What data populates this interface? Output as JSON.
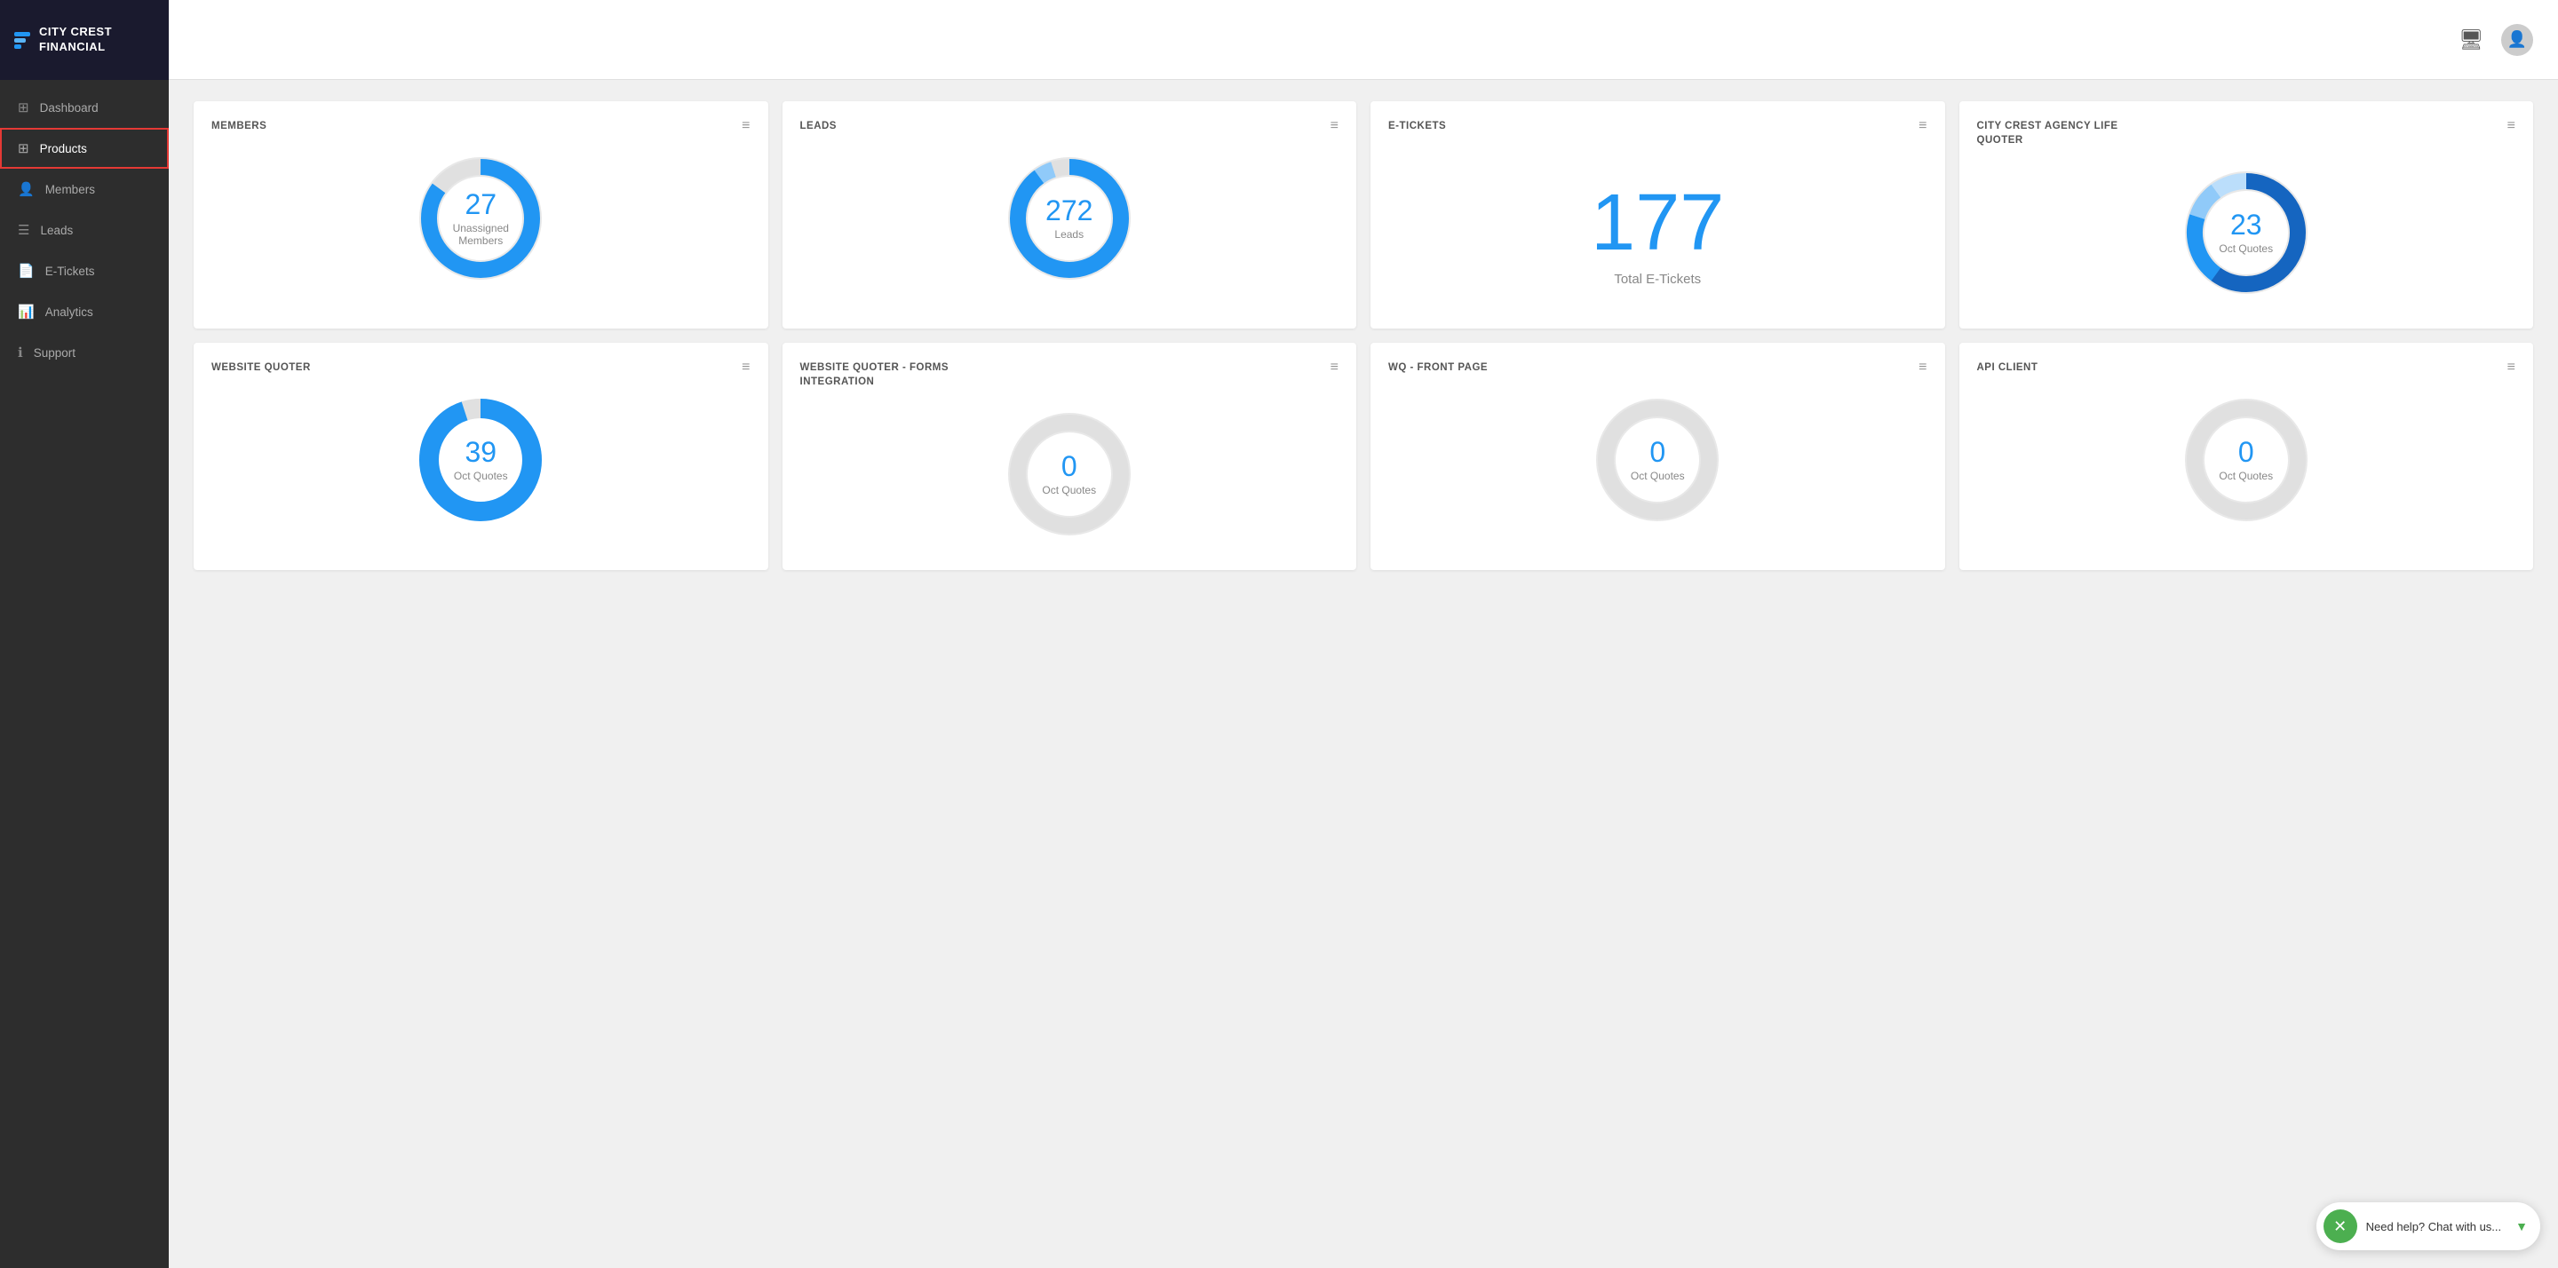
{
  "app": {
    "logo_line1": "CITY CREST",
    "logo_line2": "FINANCIAL"
  },
  "sidebar": {
    "items": [
      {
        "id": "dashboard",
        "label": "Dashboard",
        "icon": "⊞",
        "active": false
      },
      {
        "id": "products",
        "label": "Products",
        "icon": "⊞",
        "active": true
      },
      {
        "id": "members",
        "label": "Members",
        "icon": "👤",
        "active": false
      },
      {
        "id": "leads",
        "label": "Leads",
        "icon": "☰",
        "active": false
      },
      {
        "id": "etickets",
        "label": "E-Tickets",
        "icon": "📄",
        "active": false
      },
      {
        "id": "analytics",
        "label": "Analytics",
        "icon": "📊",
        "active": false
      },
      {
        "id": "support",
        "label": "Support",
        "icon": "ℹ",
        "active": false
      }
    ]
  },
  "cards": [
    {
      "id": "members",
      "title": "MEMBERS",
      "type": "donut",
      "number": "27",
      "label": "Unassigned\nMembers",
      "chart": {
        "segments": [
          {
            "value": 85,
            "color": "#2196f3",
            "stroke": 18
          },
          {
            "value": 15,
            "color": "#e0e0e0",
            "stroke": 18
          }
        ]
      }
    },
    {
      "id": "leads",
      "title": "LEADS",
      "type": "donut",
      "number": "272",
      "label": "Leads",
      "chart": {
        "segments": [
          {
            "value": 90,
            "color": "#2196f3",
            "stroke": 18
          },
          {
            "value": 5,
            "color": "#90caf9",
            "stroke": 18
          },
          {
            "value": 5,
            "color": "#e0e0e0",
            "stroke": 18
          }
        ]
      }
    },
    {
      "id": "etickets",
      "title": "E-TICKETS",
      "type": "number",
      "number": "177",
      "label": "Total E-Tickets"
    },
    {
      "id": "city-crest-quoter",
      "title": "CITY CREST AGENCY LIFE\nQUOTER",
      "type": "donut",
      "number": "23",
      "label": "Oct Quotes",
      "chart": {
        "segments": [
          {
            "value": 60,
            "color": "#1565c0",
            "stroke": 18
          },
          {
            "value": 20,
            "color": "#2196f3",
            "stroke": 18
          },
          {
            "value": 10,
            "color": "#90caf9",
            "stroke": 18
          },
          {
            "value": 10,
            "color": "#bbdefb",
            "stroke": 18
          }
        ]
      }
    },
    {
      "id": "website-quoter",
      "title": "WEBSITE QUOTER",
      "type": "donut",
      "number": "39",
      "label": "Oct Quotes",
      "chart": {
        "segments": [
          {
            "value": 95,
            "color": "#2196f3",
            "stroke": 22
          },
          {
            "value": 5,
            "color": "#e0e0e0",
            "stroke": 22
          }
        ]
      }
    },
    {
      "id": "website-quoter-forms",
      "title": "WEBSITE QUOTER - FORMS\nINTEGRATION",
      "type": "donut",
      "number": "0",
      "label": "Oct Quotes",
      "chart": {
        "segments": [
          {
            "value": 100,
            "color": "#e0e0e0",
            "stroke": 18
          }
        ]
      }
    },
    {
      "id": "wq-front-page",
      "title": "WQ - FRONT PAGE",
      "type": "donut",
      "number": "0",
      "label": "Oct Quotes",
      "chart": {
        "segments": [
          {
            "value": 100,
            "color": "#e0e0e0",
            "stroke": 18
          }
        ]
      }
    },
    {
      "id": "api-client",
      "title": "API CLIENT",
      "type": "donut",
      "number": "0",
      "label": "Oct Quotes",
      "chart": {
        "segments": [
          {
            "value": 100,
            "color": "#e0e0e0",
            "stroke": 18
          }
        ]
      }
    }
  ],
  "chat": {
    "text": "Need help? Chat with us...",
    "icon": "✕"
  }
}
